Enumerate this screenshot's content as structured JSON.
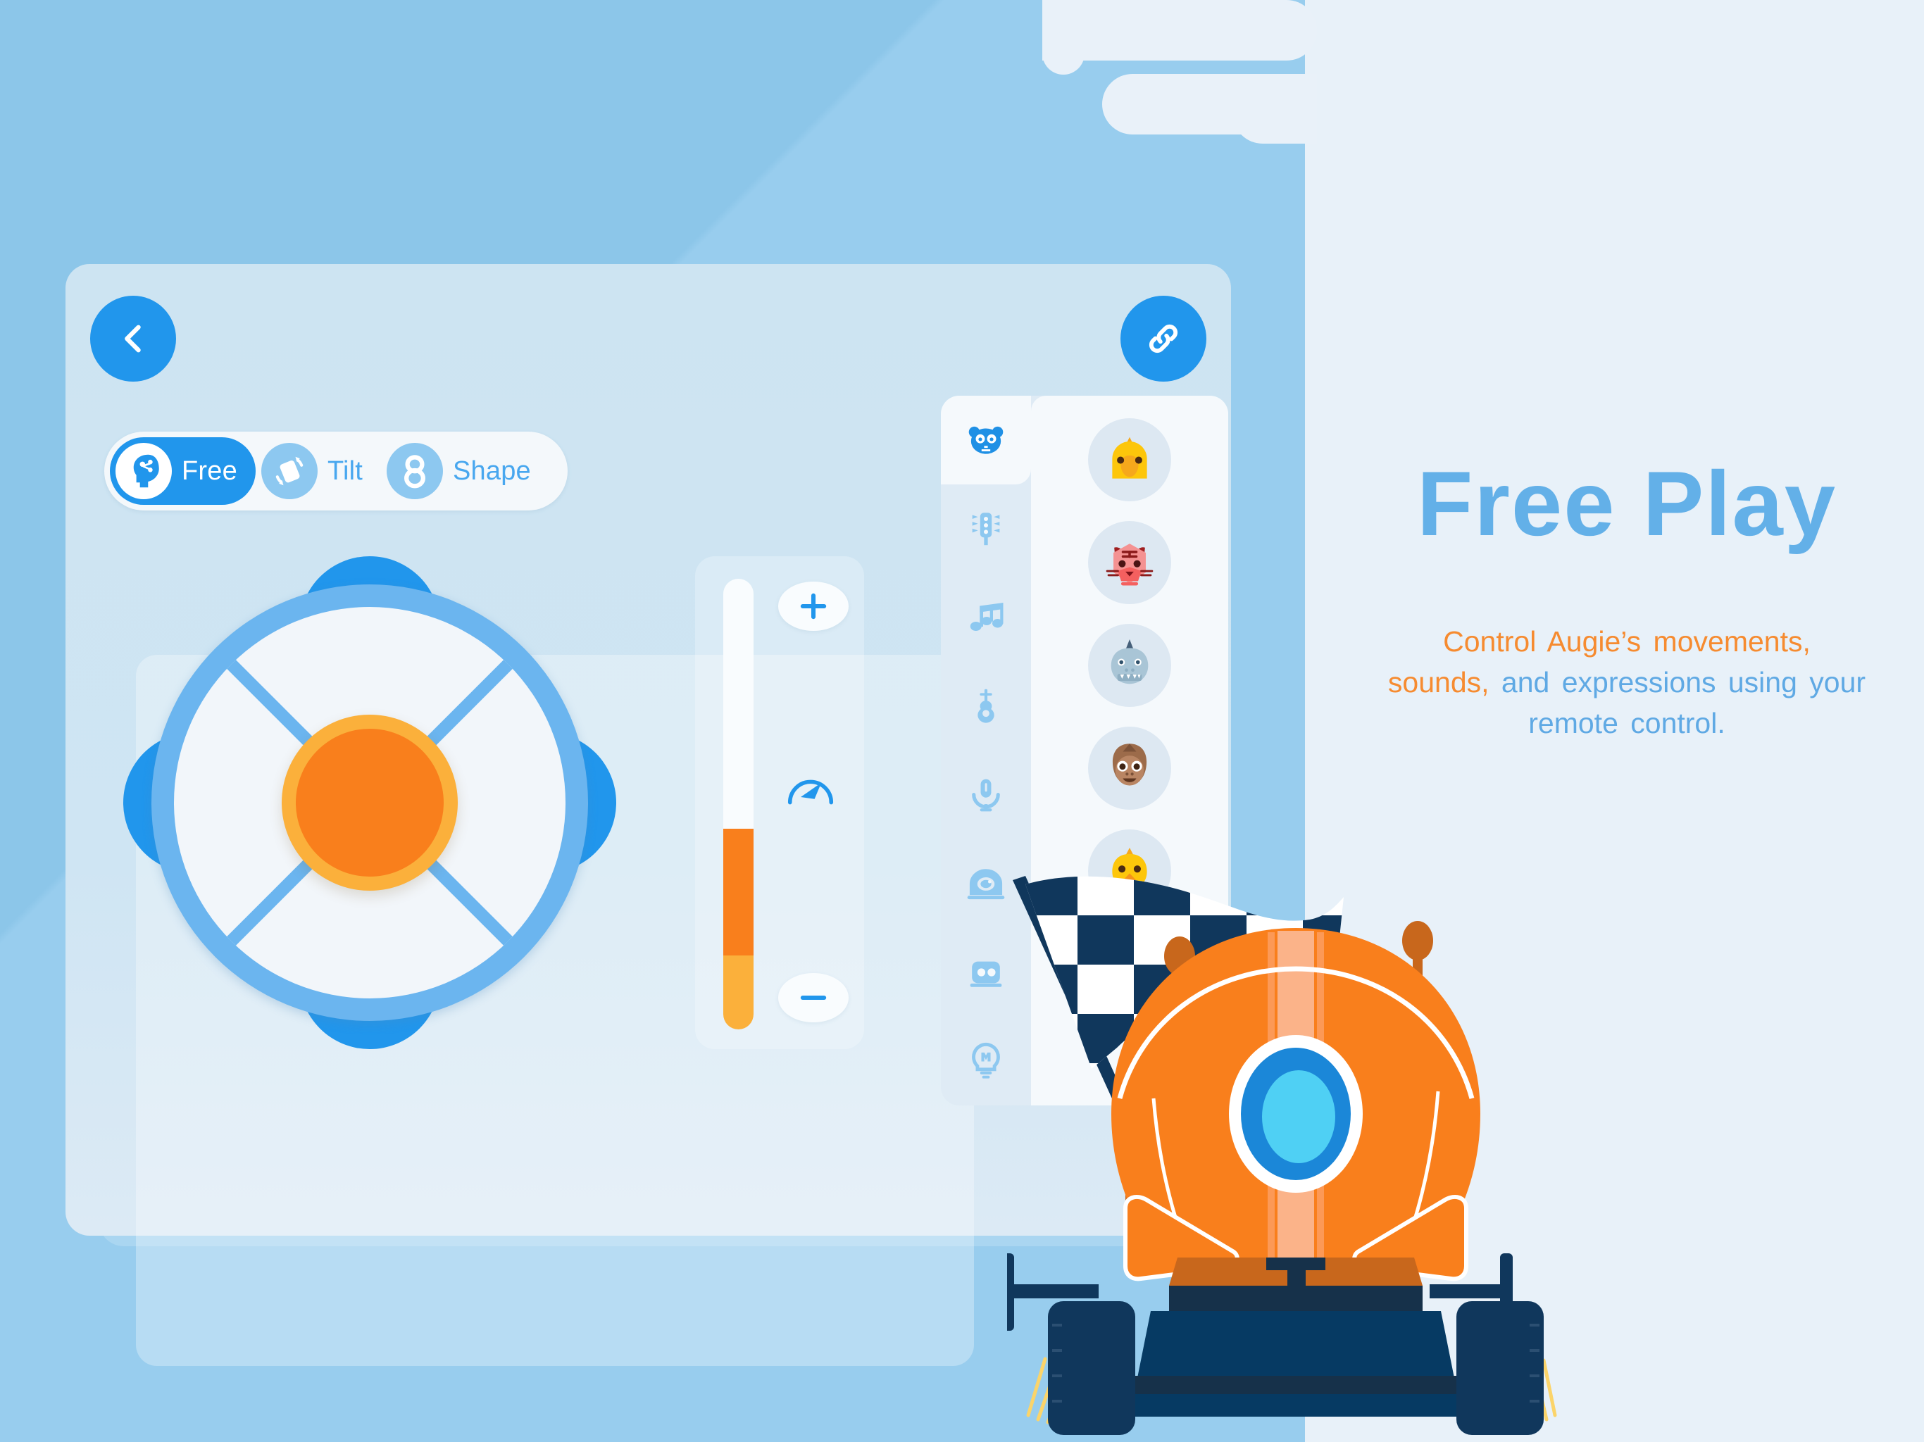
{
  "theme": {
    "bg_left": "#95cbec",
    "bg_right": "#e8f1f9",
    "accent_blue": "#2196ec",
    "accent_orange": "#f97f1c",
    "accent_yellow": "#fbb03b",
    "title_blue": "#63b0e8",
    "navy": "#10375c"
  },
  "header": {
    "back_button": "back-arrow",
    "link_button": "link"
  },
  "modes": {
    "selected": "Free",
    "items": [
      {
        "label": "Free",
        "icon": "brain-head-icon",
        "active": true
      },
      {
        "label": "Tilt",
        "icon": "device-rotate-icon",
        "active": false
      },
      {
        "label": "Shape",
        "icon": "figure-eight-icon",
        "active": false
      }
    ]
  },
  "dpad": {
    "up": "chevron-up-icon",
    "down": "chevron-down-icon",
    "left": "chevron-left-icon",
    "right": "chevron-right-icon",
    "center": "joystick-center-button"
  },
  "speed": {
    "increase_label": "+",
    "decrease_label": "—",
    "meter_icon": "speedometer-icon",
    "fill_percent": 45,
    "orange_percent": 28,
    "yellow_percent": 17
  },
  "side_rail": {
    "active_index": 0,
    "items": [
      {
        "icon": "panda-face-icon",
        "active": true
      },
      {
        "icon": "traffic-light-icon",
        "active": false
      },
      {
        "icon": "music-notes-icon",
        "active": false
      },
      {
        "icon": "guitar-icon",
        "active": false
      },
      {
        "icon": "microphone-icon",
        "active": false
      },
      {
        "icon": "camera-eye-icon",
        "active": false
      },
      {
        "icon": "robot-body-icon",
        "active": false
      },
      {
        "icon": "lightbulb-m-icon",
        "active": false
      }
    ]
  },
  "avatars": [
    {
      "icon": "bird-avatar",
      "color": "#fdc60b"
    },
    {
      "icon": "tiger-avatar",
      "color": "#f49292"
    },
    {
      "icon": "rhino-avatar",
      "color": "#a9c5d6"
    },
    {
      "icon": "monkey-avatar",
      "color": "#9c6b4a"
    },
    {
      "icon": "chick-avatar",
      "color": "#fdc60b"
    }
  ],
  "info": {
    "title": "Free Play",
    "description_highlight": "Control Augie’s movements, sounds,",
    "description_rest": " and expressions using your remote control."
  },
  "illustration": {
    "robot": "orange-dome-robot",
    "flag": "checkered-race-flag"
  }
}
